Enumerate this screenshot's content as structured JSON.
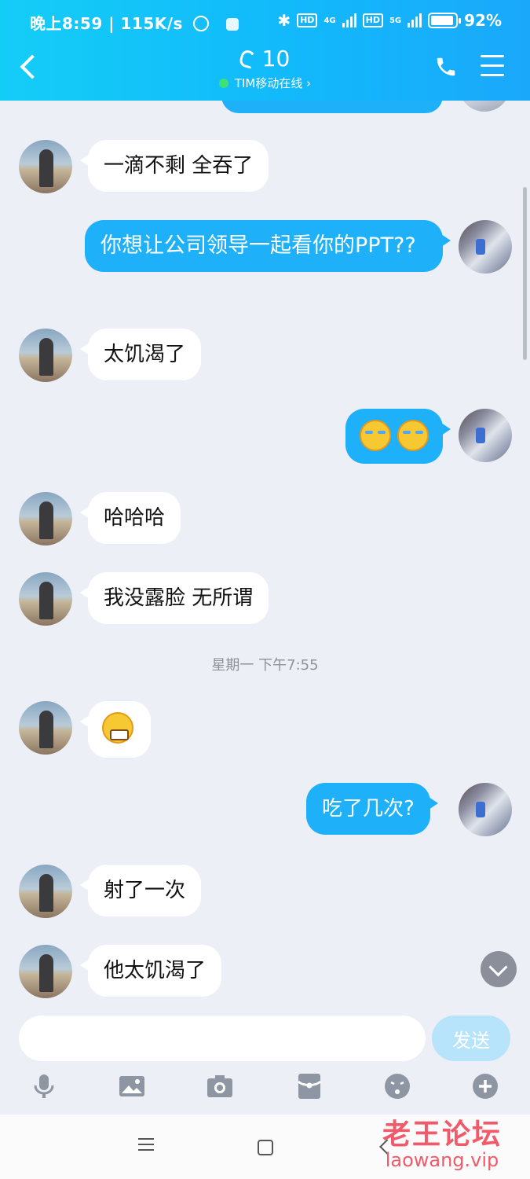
{
  "status_bar": {
    "time": "晚上8:59",
    "speed": "115K/s",
    "network_1": "4G",
    "network_2": "5G",
    "hd": "HD",
    "battery": "92%"
  },
  "header": {
    "title": "10",
    "subtitle": "TIM移动在线 ›",
    "back_icon": "chevron-left-icon",
    "call_icon": "phone-icon",
    "menu_icon": "hamburger-menu-icon",
    "online_color": "#3fe07a"
  },
  "messages": [
    {
      "sender": "friend",
      "text": "一滴不剩 全吞了"
    },
    {
      "sender": "me",
      "text": "你想让公司领导一起看你的PPT??"
    },
    {
      "sender": "friend",
      "text": "太饥渴了"
    },
    {
      "sender": "me",
      "emoji": "crying-laughing-emoji x2"
    },
    {
      "sender": "friend",
      "text": "哈哈哈"
    },
    {
      "sender": "friend",
      "text": "我没露脸 无所谓"
    },
    {
      "sender": "friend",
      "emoji": "grinning-emoji"
    },
    {
      "sender": "me",
      "text": "吃了几次?"
    },
    {
      "sender": "friend",
      "text": "射了一次"
    },
    {
      "sender": "friend",
      "text": "他太饥渴了"
    }
  ],
  "timestamp": "星期一 下午7:55",
  "input": {
    "placeholder": "",
    "send_label": "发送"
  },
  "toolbar_icons": [
    "mic-icon",
    "image-icon",
    "camera-icon",
    "red-packet-icon",
    "emoji-icon",
    "plus-icon"
  ],
  "watermark": {
    "title": "老王论坛",
    "url": "laowang.vip"
  },
  "colors": {
    "header": "#12b9fb",
    "bubble_out": "#1eb0f8",
    "bubble_in": "#ffffff",
    "background": "#eceff5",
    "send_button": "#b7e4fb",
    "watermark": "#f15a6a"
  }
}
